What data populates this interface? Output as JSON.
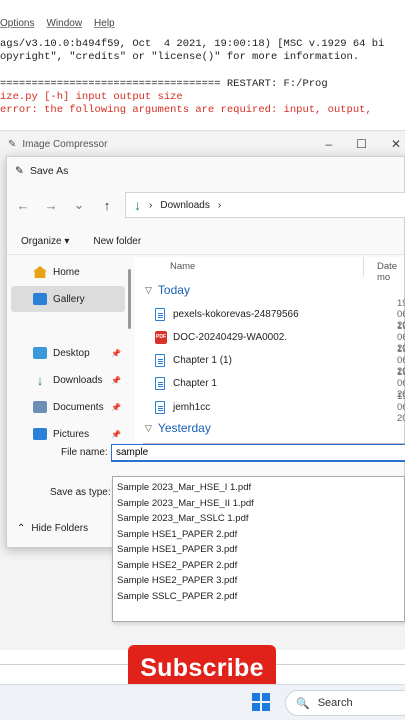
{
  "idle": {
    "menu": [
      "Options",
      "Window",
      "Help"
    ],
    "lines": [
      "ags/v3.10.0:b494f59, Oct  4 2021, 19:00:18) [MSC v.1929 64 bi",
      "opyright\", \"credits\" or \"license()\" for more information.",
      "=================================== RESTART: F:/Prog",
      "ize.py [-h] input output size",
      "error: the following arguments are required: input, output,"
    ]
  },
  "parent_window": {
    "title": "Image Compressor",
    "controls": [
      "–",
      "☐",
      "✕"
    ]
  },
  "dialog": {
    "title": "Save As",
    "nav": {
      "back": "←",
      "forward": "→",
      "recent": "⌄",
      "up": "↑"
    },
    "address": {
      "folder": "Downloads",
      "sep": "›"
    },
    "toolbar": {
      "organize": "Organize ▾",
      "new_folder": "New folder"
    },
    "sidebar": [
      {
        "label": "Home"
      },
      {
        "label": "Gallery"
      },
      {
        "label": "Desktop"
      },
      {
        "label": "Downloads"
      },
      {
        "label": "Documents"
      },
      {
        "label": "Pictures"
      }
    ],
    "columns": {
      "name": "Name",
      "date": "Date mo"
    },
    "groups": {
      "today": "Today",
      "yesterday": "Yesterday"
    },
    "files": [
      {
        "name": "pexels-kokorevas-24879566",
        "date": "19-06-20"
      },
      {
        "name": "DOC-20240429-WA0002.",
        "date": "19-06-20"
      },
      {
        "name": "Chapter 1 (1)",
        "date": "19-06-20"
      },
      {
        "name": "Chapter 1",
        "date": "19-06-20"
      },
      {
        "name": "jemh1cc",
        "date": "19-06-20"
      }
    ],
    "file_name_label": "File name:",
    "file_name_value": "sample",
    "save_as_type_label": "Save as type:",
    "hide_folders": "Hide Folders",
    "suggestions": [
      "Sample 2023_Mar_HSE_I 1.pdf",
      "Sample 2023_Mar_HSE_II 1.pdf",
      "Sample 2023_Mar_SSLC 1.pdf",
      "Sample HSE1_PAPER 2.pdf",
      "Sample HSE1_PAPER 3.pdf",
      "Sample HSE2_PAPER 2.pdf",
      "Sample HSE2_PAPER 3.pdf",
      "Sample SSLC_PAPER 2.pdf"
    ]
  },
  "overlay": {
    "subscribe": "Subscribe"
  },
  "taskbar": {
    "search": "Search"
  }
}
